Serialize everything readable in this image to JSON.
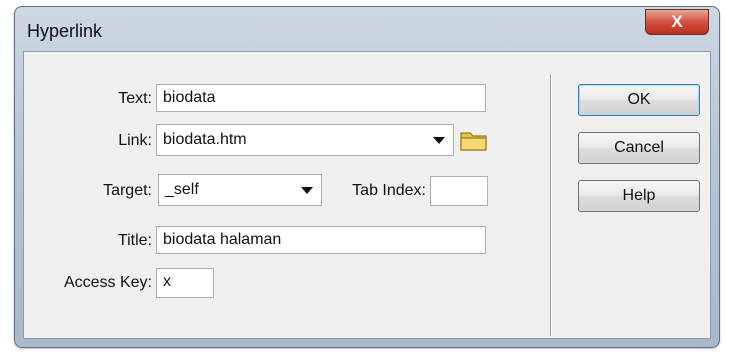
{
  "window": {
    "title": "Hyperlink",
    "close_label": "X"
  },
  "form": {
    "text_label": "Text:",
    "text_value": "biodata",
    "link_label": "Link:",
    "link_value": "biodata.htm",
    "target_label": "Target:",
    "target_value": "_self",
    "tab_index_label": "Tab Index:",
    "tab_index_value": "",
    "title_label": "Title:",
    "title_value": "biodata halaman",
    "access_key_label": "Access Key:",
    "access_key_value": "x"
  },
  "buttons": {
    "ok": "OK",
    "cancel": "Cancel",
    "help": "Help"
  },
  "icons": {
    "folder": "folder-icon",
    "close": "close-icon",
    "dropdown": "chevron-down-icon"
  },
  "colors": {
    "close_red": "#c94434",
    "folder_yellow": "#e8c34c",
    "default_button_border": "#3c7fb1"
  }
}
